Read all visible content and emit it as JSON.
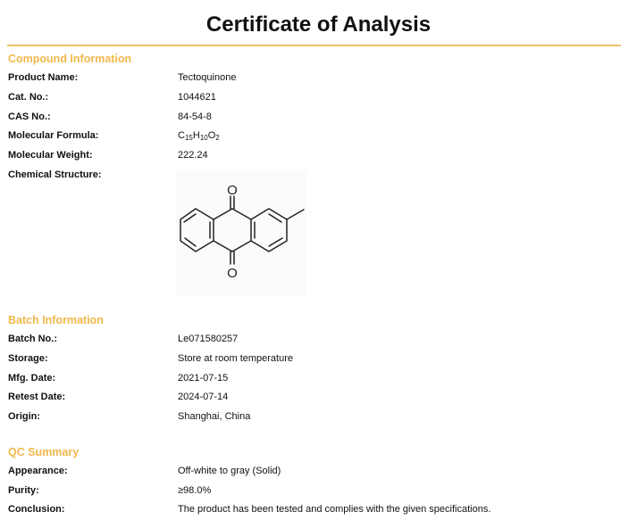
{
  "title": "Certificate of Analysis",
  "compound": {
    "heading": "Compound Information",
    "product_name_label": "Product Name:",
    "product_name": "Tectoquinone",
    "cat_no_label": "Cat. No.:",
    "cat_no": "1044621",
    "cas_no_label": "CAS No.:",
    "cas_no": "84-54-8",
    "formula_label": "Molecular Formula:",
    "formula": {
      "c": "C",
      "c_count": "15",
      "h": "H",
      "h_count": "10",
      "o": "O",
      "o_count": "2"
    },
    "mw_label": "Molecular Weight:",
    "mw": "222.24",
    "structure_label": "Chemical Structure:",
    "structure_atoms": {
      "o_top": "O",
      "o_bottom": "O"
    }
  },
  "batch": {
    "heading": "Batch Information",
    "batch_no_label": "Batch No.:",
    "batch_no": "Le071580257",
    "storage_label": "Storage:",
    "storage": "Store at room temperature",
    "mfg_label": "Mfg. Date:",
    "mfg": "2021-07-15",
    "retest_label": "Retest Date:",
    "retest": "2024-07-14",
    "origin_label": "Origin:",
    "origin": "Shanghai, China"
  },
  "qc": {
    "heading": "QC Summary",
    "appearance_label": "Appearance:",
    "appearance": "Off-white to gray (Solid)",
    "purity_label": "Purity:",
    "purity": "≥98.0%",
    "conclusion_label": "Conclusion:",
    "conclusion": "The product has been tested and complies with the given specifications."
  },
  "colors": {
    "accent": "#f2b84b",
    "rule": "#f0c26a",
    "text": "#111111"
  }
}
